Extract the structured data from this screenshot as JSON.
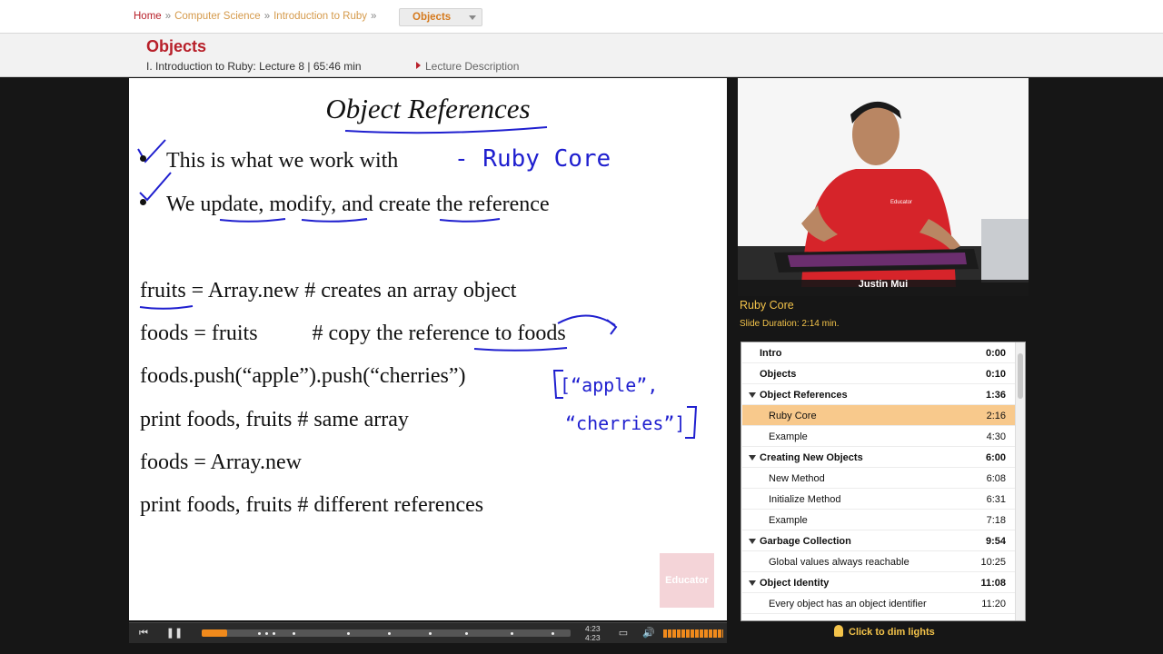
{
  "breadcrumb": {
    "home": "Home",
    "sep": "»",
    "items": [
      "Computer Science",
      "Introduction to Ruby"
    ],
    "current": "Objects"
  },
  "header": {
    "title": "Objects",
    "meta": "I. Introduction to Ruby: Lecture 8 | 65:46 min",
    "description_link": "Lecture Description"
  },
  "slide": {
    "title": "Object References",
    "bullets": [
      "This is what we work with",
      "We update, modify, and create the reference"
    ],
    "code": [
      "fruits = Array.new # creates an array object",
      "foods = fruits          # copy the reference to foods",
      "foods.push(“apple”).push(“cherries”)",
      "print foods, fruits  # same array",
      "foods = Array.new",
      "print foods, fruits # different references"
    ],
    "handwriting": {
      "note1": "- Ruby  Core",
      "note2a": "[“apple”,",
      "note2b": "“cherries”]"
    },
    "watermark": "Educator"
  },
  "player": {
    "time_current": "4:23",
    "time_total": "4:23",
    "progress_fraction": 0.07,
    "volume_fraction": 1.0
  },
  "video": {
    "instructor": "Justin Mui",
    "shirt_logo": "Educator"
  },
  "current_slide": {
    "name": "Ruby Core",
    "duration": "Slide Duration: 2:14 min."
  },
  "outline": [
    {
      "label": "Intro",
      "time": "0:00",
      "section": true,
      "expandable": false,
      "selected": false
    },
    {
      "label": "Objects",
      "time": "0:10",
      "section": true,
      "expandable": false,
      "selected": false
    },
    {
      "label": "Object References",
      "time": "1:36",
      "section": true,
      "expandable": true,
      "selected": false
    },
    {
      "label": "Ruby Core",
      "time": "2:16",
      "section": false,
      "expandable": false,
      "selected": true
    },
    {
      "label": "Example",
      "time": "4:30",
      "section": false,
      "expandable": false,
      "selected": false
    },
    {
      "label": "Creating New Objects",
      "time": "6:00",
      "section": true,
      "expandable": true,
      "selected": false
    },
    {
      "label": "New Method",
      "time": "6:08",
      "section": false,
      "expandable": false,
      "selected": false
    },
    {
      "label": "Initialize Method",
      "time": "6:31",
      "section": false,
      "expandable": false,
      "selected": false
    },
    {
      "label": "Example",
      "time": "7:18",
      "section": false,
      "expandable": false,
      "selected": false
    },
    {
      "label": "Garbage Collection",
      "time": "9:54",
      "section": true,
      "expandable": true,
      "selected": false
    },
    {
      "label": "Global values always reachable",
      "time": "10:25",
      "section": false,
      "expandable": false,
      "selected": false
    },
    {
      "label": "Object Identity",
      "time": "11:08",
      "section": true,
      "expandable": true,
      "selected": false
    },
    {
      "label": "Every object has an object identifier",
      "time": "11:20",
      "section": false,
      "expandable": false,
      "selected": false
    }
  ],
  "dim_lights": "Click to dim lights",
  "colors": {
    "brand_red": "#b8202a",
    "accent_orange": "#f08a1c",
    "highlight": "#f8c98c",
    "handwriting_blue": "#1f1fcf",
    "caption_yellow": "#f3c34a"
  }
}
